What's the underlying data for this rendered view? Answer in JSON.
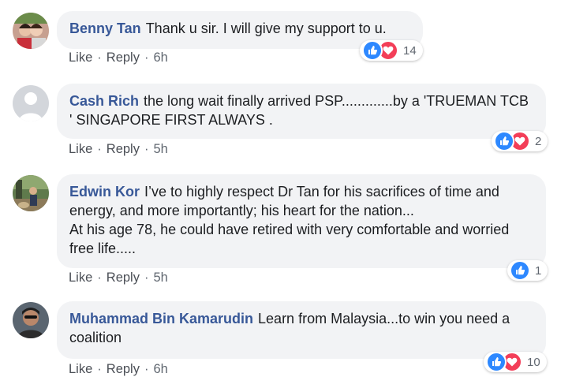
{
  "colors": {
    "name": "#385898",
    "bubble": "#f2f3f5",
    "like": "#2d88ff",
    "love": "#f33e58",
    "meta": "#606770"
  },
  "comments": [
    {
      "author": "Benny Tan",
      "text": "Thank u sir. I will give my support to u.",
      "like_label": "Like",
      "reply_label": "Reply",
      "sep": "·",
      "time": "6h",
      "reactions": [
        "like-icon",
        "love-icon"
      ],
      "reaction_count": "14"
    },
    {
      "author": "Cash Rich",
      "text": "the long wait finally arrived PSP.............by a 'TRUEMAN TCB ' SINGAPORE FIRST ALWAYS .",
      "like_label": "Like",
      "reply_label": "Reply",
      "sep": "·",
      "time": "5h",
      "reactions": [
        "like-icon",
        "love-icon"
      ],
      "reaction_count": "2"
    },
    {
      "author": "Edwin Kor",
      "text": "I’ve to highly respect Dr Tan for his sacrifices of time and energy, and more importantly; his heart for the nation...",
      "text2": "At his age 78, he could have retired with very comfortable and worried free life.....",
      "like_label": "Like",
      "reply_label": "Reply",
      "sep": "·",
      "time": "5h",
      "reactions": [
        "like-icon"
      ],
      "reaction_count": "1"
    },
    {
      "author": "Muhammad Bin Kamarudin",
      "text": "Learn from Malaysia...to win you need a coalition",
      "like_label": "Like",
      "reply_label": "Reply",
      "sep": "·",
      "time": "6h",
      "reactions": [
        "like-icon",
        "love-icon"
      ],
      "reaction_count": "10"
    }
  ]
}
